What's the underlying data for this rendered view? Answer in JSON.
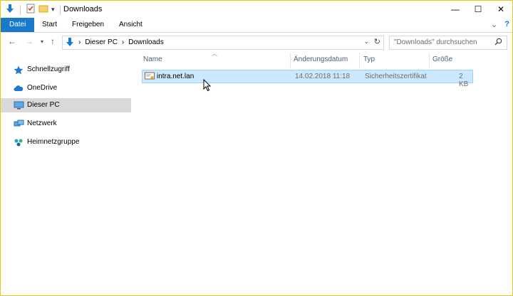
{
  "window": {
    "title": "Downloads",
    "controls": {
      "minimize": "—",
      "maximize": "☐",
      "close": "✕"
    }
  },
  "ribbon": {
    "tabs": [
      {
        "label": "Datei"
      },
      {
        "label": "Start"
      },
      {
        "label": "Freigeben"
      },
      {
        "label": "Ansicht"
      }
    ],
    "expand": "⌄",
    "help": "?"
  },
  "address": {
    "crumbs": [
      "Dieser PC",
      "Downloads"
    ],
    "separator": "›"
  },
  "search": {
    "placeholder": "\"Downloads\" durchsuchen"
  },
  "nav": {
    "items": [
      {
        "label": "Schnellzugriff",
        "icon": "star-icon"
      },
      {
        "label": "OneDrive",
        "icon": "cloud-icon"
      },
      {
        "label": "Dieser PC",
        "icon": "computer-icon"
      },
      {
        "label": "Netzwerk",
        "icon": "network-icon"
      },
      {
        "label": "Heimnetzgruppe",
        "icon": "homegroup-icon"
      }
    ]
  },
  "columns": {
    "name": "Name",
    "date": "Änderungsdatum",
    "type": "Typ",
    "size": "Größe"
  },
  "files": [
    {
      "name": "intra.net.lan",
      "date": "14.02.2018 11:18",
      "type": "Sicherheitszertifikat",
      "size": "2 KB"
    }
  ],
  "colors": {
    "accent": "#1979ca",
    "selection": "#cce8ff",
    "selection_border": "#99d1ff",
    "border": "#f0c419"
  }
}
